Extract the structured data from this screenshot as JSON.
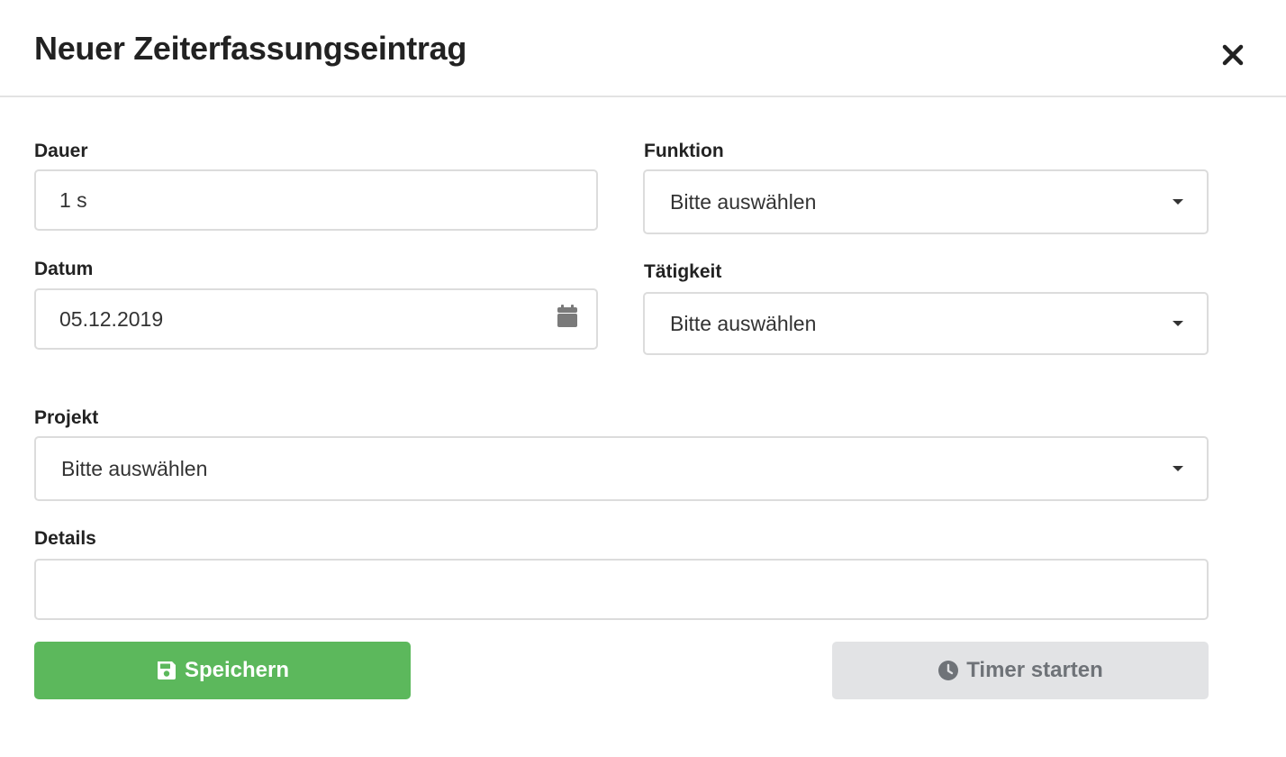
{
  "modal": {
    "title": "Neuer Zeiterfassungseintrag",
    "close_icon": "close-icon"
  },
  "form": {
    "dauer": {
      "label": "Dauer",
      "value": "1 s"
    },
    "datum": {
      "label": "Datum",
      "value": "05.12.2019",
      "icon": "calendar-icon"
    },
    "funktion": {
      "label": "Funktion",
      "selected": "Bitte auswählen"
    },
    "taetigkeit": {
      "label": "Tätigkeit",
      "selected": "Bitte auswählen"
    },
    "projekt": {
      "label": "Projekt",
      "selected": "Bitte auswählen"
    },
    "details": {
      "label": "Details",
      "value": ""
    }
  },
  "actions": {
    "save_label": "Speichern",
    "save_icon": "floppy-disk-icon",
    "timer_label": "Timer starten",
    "timer_icon": "clock-icon"
  },
  "colors": {
    "save_bg": "#5cb85c",
    "timer_bg": "#e2e3e5",
    "timer_text": "#6f7378",
    "border": "#dcdcdc"
  }
}
